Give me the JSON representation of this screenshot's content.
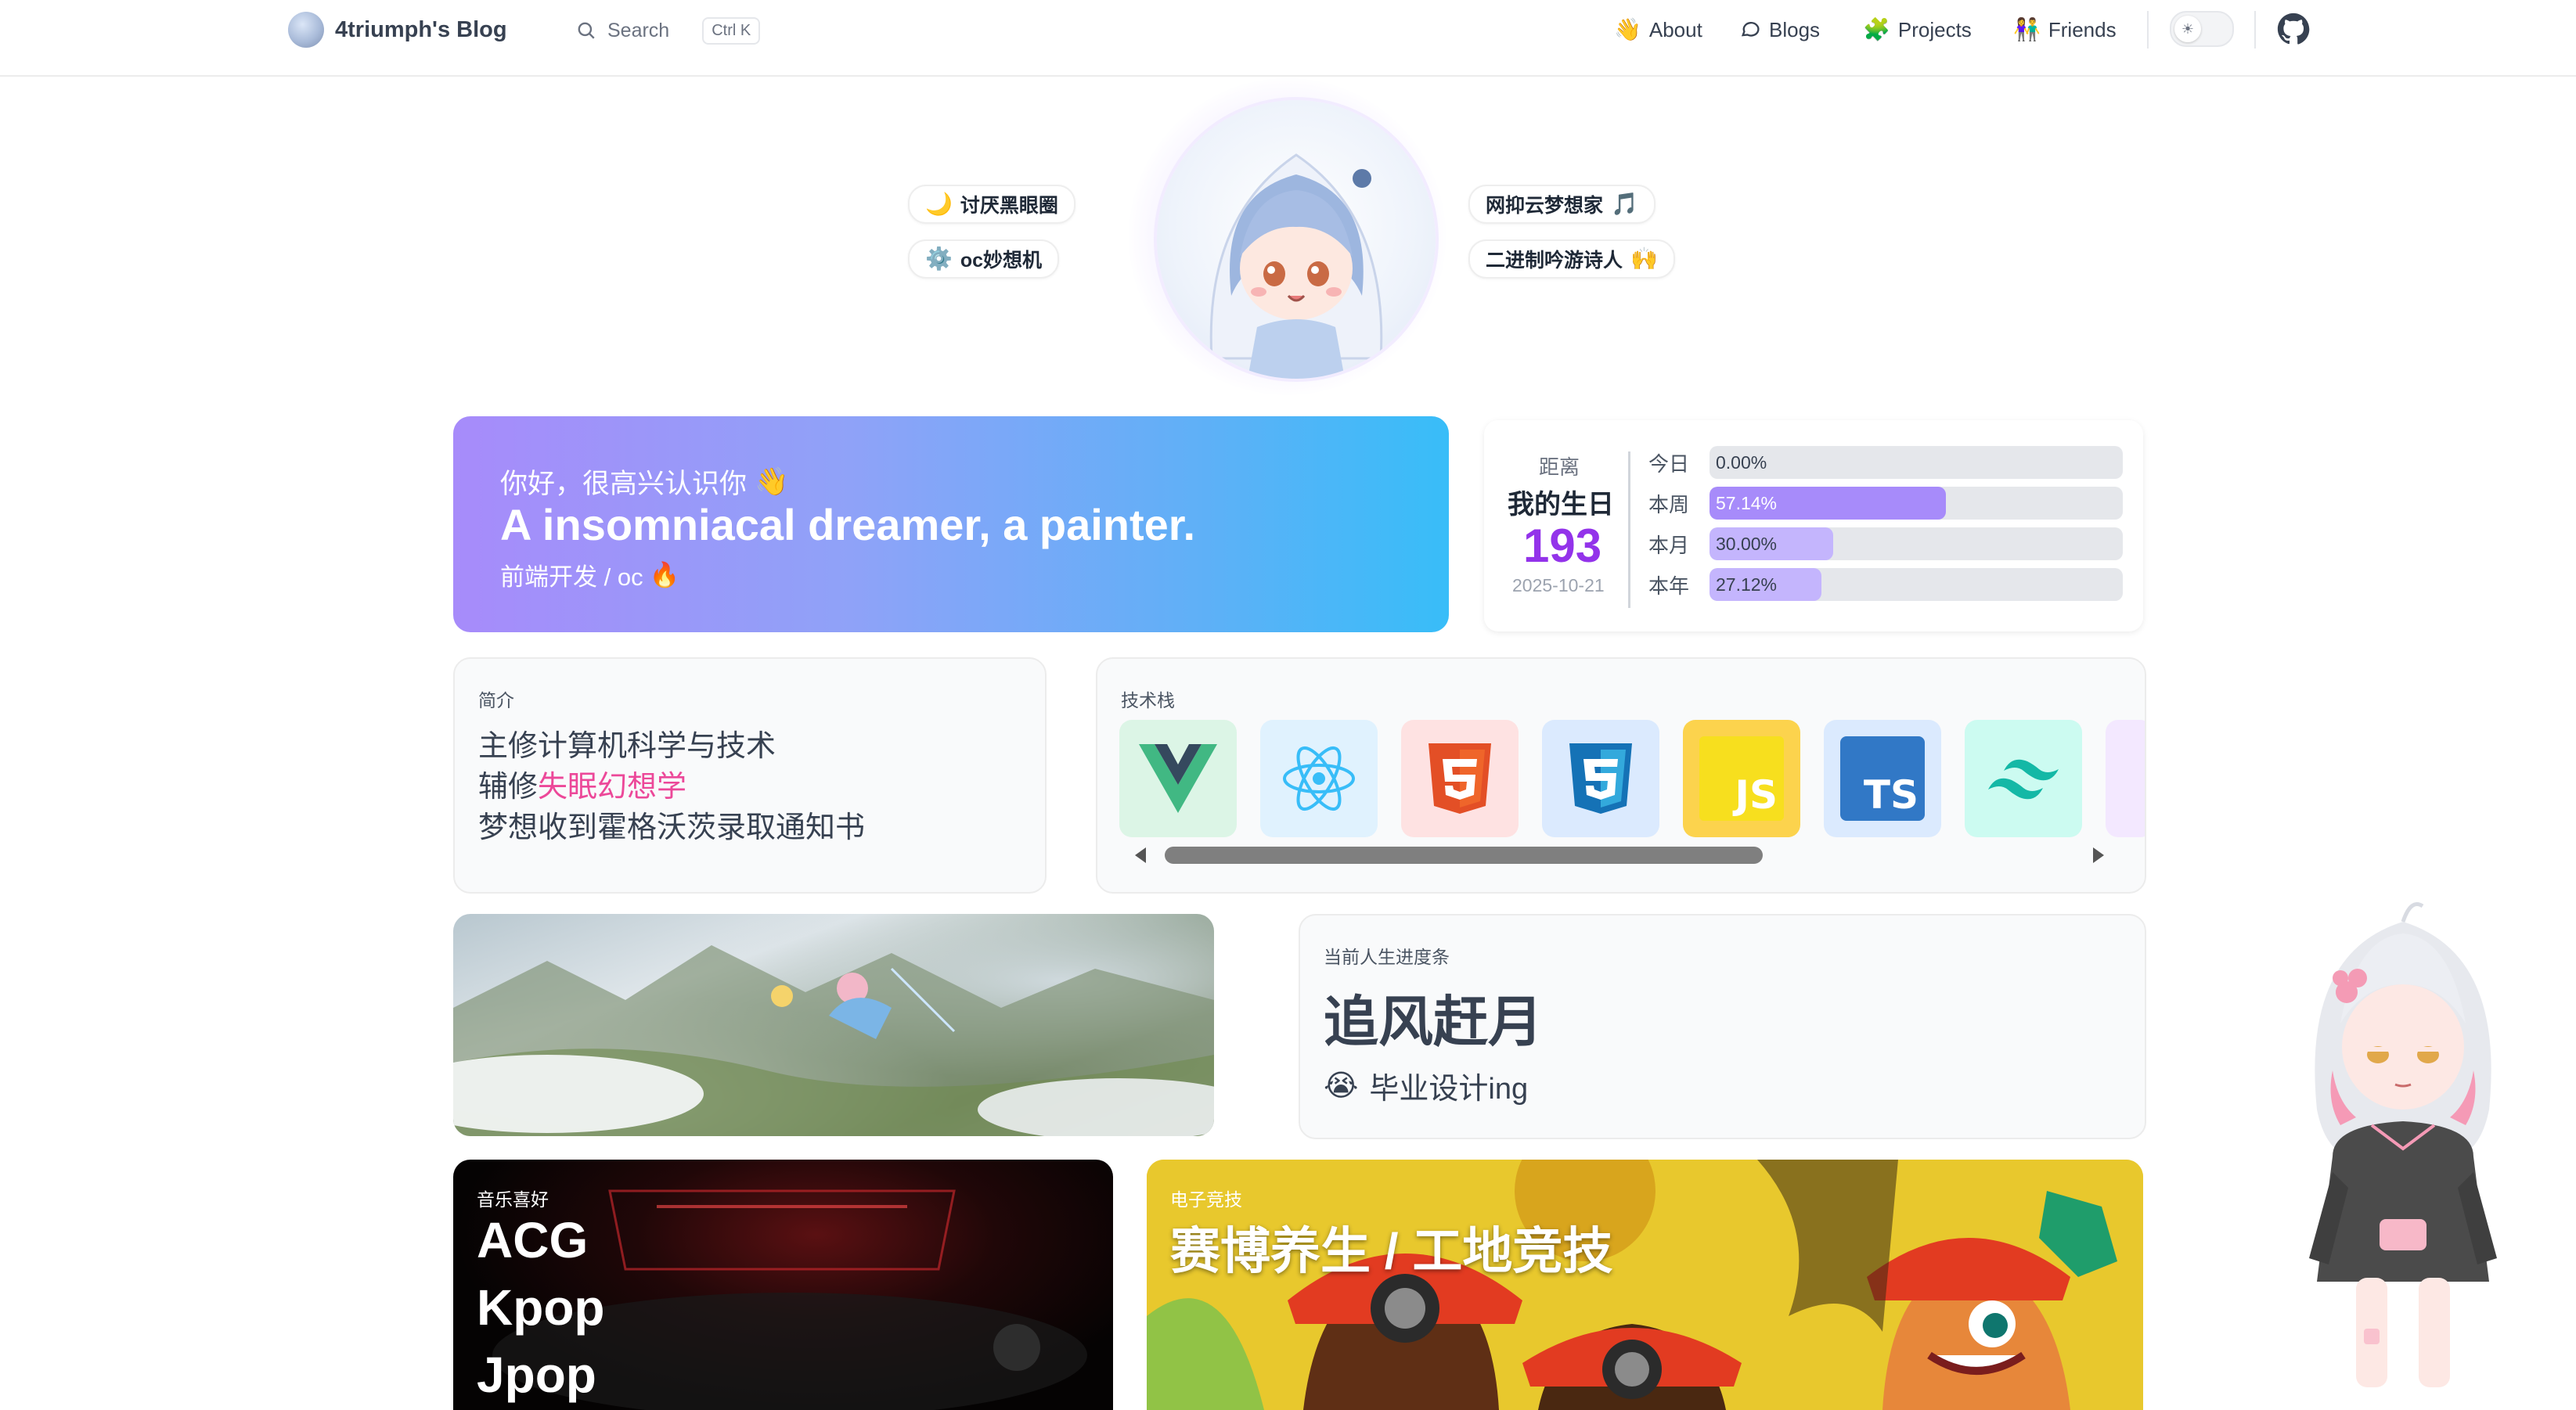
{
  "header": {
    "title": "4triumph's Blog",
    "search_label": "Search",
    "search_shortcut": "Ctrl K",
    "nav": [
      {
        "label": "About",
        "icon": "👋"
      },
      {
        "label": "Blogs",
        "icon": "chat-bubble-icon"
      },
      {
        "label": "Projects",
        "icon": "🧩"
      },
      {
        "label": "Friends",
        "icon": "👫"
      }
    ]
  },
  "hero": {
    "tags_left": [
      {
        "label": "讨厌黑眼圈",
        "icon": "🌙"
      },
      {
        "label": "oc妙想机",
        "icon": "⚙️"
      }
    ],
    "tags_right": [
      {
        "label": "网抑云梦想家",
        "icon": "🎵"
      },
      {
        "label": "二进制吟游诗人",
        "icon": "🙌"
      }
    ]
  },
  "hello": {
    "greeting": "你好，很高兴认识你",
    "greeting_icon": "👋",
    "headline": "A insomniacal dreamer, a painter.",
    "role": "前端开发 / oc",
    "role_icon": "🔥"
  },
  "countdown": {
    "prefix": "距离",
    "title": "我的生日",
    "days": "193",
    "date": "2025-10-21",
    "rows": [
      {
        "name": "今日",
        "value": "0.00%",
        "fraction": 0.0
      },
      {
        "name": "本周",
        "value": "57.14%",
        "fraction": 0.5714
      },
      {
        "name": "本月",
        "value": "30.00%",
        "fraction": 0.3
      },
      {
        "name": "本年",
        "value": "27.12%",
        "fraction": 0.2712
      }
    ]
  },
  "intro": {
    "title": "简介",
    "line1": "主修计算机科学与技术",
    "line2_prefix": "辅修",
    "line2_accent": "失眠幻想学",
    "line3": "梦想收到霍格沃茨录取通知书"
  },
  "tech": {
    "title": "技术栈",
    "items": [
      "Vue",
      "React",
      "HTML5",
      "CSS3",
      "JS",
      "TS",
      "Tailwind"
    ],
    "scroll_position": 0.28
  },
  "progress": {
    "title": "当前人生进度条",
    "headline": "追风赶月",
    "status": "毕业设计ing",
    "status_icon": "😭"
  },
  "music": {
    "title": "音乐喜好",
    "lines": [
      "ACG",
      "Kpop",
      "Jpop"
    ]
  },
  "esports": {
    "title": "电子竞技",
    "headline": "赛博养生 / 工地竞技"
  },
  "colors": {
    "accent_purple": "#9333ea",
    "accent_pink": "#ec4899",
    "gradient_start": "#a78bfa",
    "gradient_end": "#38bdf8"
  }
}
